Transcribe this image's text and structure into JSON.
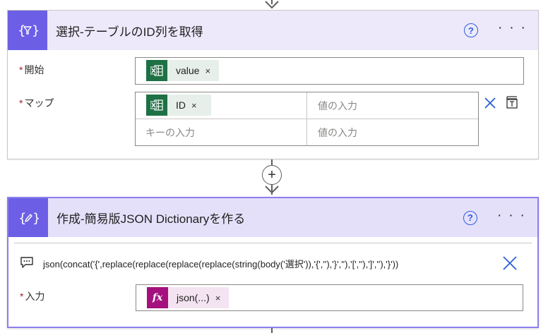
{
  "card_select": {
    "title": "選択-テーブルのID列を取得",
    "help_label": "?",
    "more_label": "· · ·",
    "from": {
      "label": "開始",
      "required_mark": "*",
      "token": {
        "text": "value",
        "remove": "×",
        "icon": "excel-icon",
        "color": "#e6efe9"
      }
    },
    "map": {
      "label": "マップ",
      "required_mark": "*",
      "rows": [
        {
          "key_token": {
            "text": "ID",
            "remove": "×",
            "icon": "excel-icon"
          },
          "value_placeholder": "値の入力"
        },
        {
          "key_placeholder": "キーの入力",
          "value_placeholder": "値の入力"
        }
      ]
    },
    "accent": "#6c5fe6"
  },
  "card_compose": {
    "title": "作成-簡易版JSON Dictionaryを作る",
    "help_label": "?",
    "more_label": "· · ·",
    "expression": "json(concat('{',replace(replace(replace(replace(string(body('選択')),'{',''),'}',''),'[',''),']',''),'}'))",
    "input": {
      "label": "入力",
      "required_mark": "*",
      "token": {
        "text": "json(...)",
        "remove": "×",
        "icon": "fx-icon",
        "color": "#f4e3f1"
      }
    },
    "accent": "#8b7ff0"
  },
  "add_step": {
    "label": "+"
  }
}
